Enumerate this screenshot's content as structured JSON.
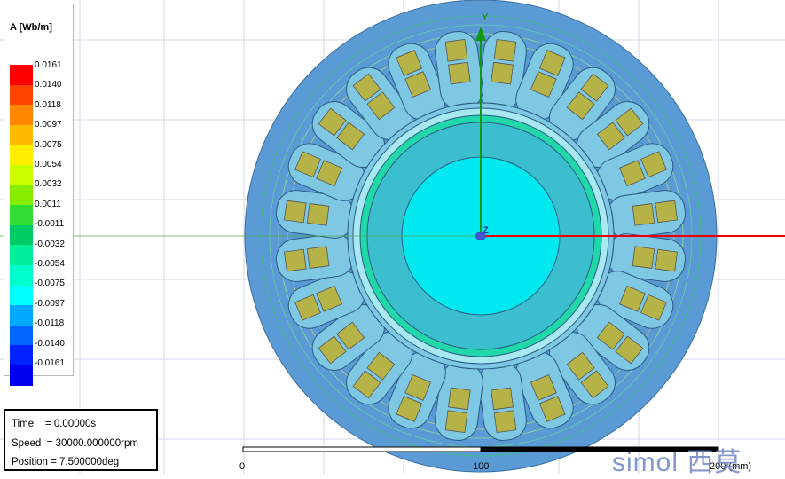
{
  "legend": {
    "title": "A [Wb/m]",
    "entries": [
      {
        "label": "0.0161",
        "color": "#ff0000"
      },
      {
        "label": "0.0140",
        "color": "#ff4400"
      },
      {
        "label": "0.0118",
        "color": "#ff8800"
      },
      {
        "label": "0.0097",
        "color": "#ffbb00"
      },
      {
        "label": "0.0075",
        "color": "#ffee00"
      },
      {
        "label": "0.0054",
        "color": "#ccff00"
      },
      {
        "label": "0.0032",
        "color": "#88ee00"
      },
      {
        "label": "0.0011",
        "color": "#33dd33"
      },
      {
        "label": "-0.0011",
        "color": "#00cc66"
      },
      {
        "label": "-0.0032",
        "color": "#00ee99"
      },
      {
        "label": "-0.0054",
        "color": "#00ffcc"
      },
      {
        "label": "-0.0075",
        "color": "#00ffff"
      },
      {
        "label": "-0.0097",
        "color": "#00aaff"
      },
      {
        "label": "-0.0118",
        "color": "#0066ff"
      },
      {
        "label": "-0.0140",
        "color": "#0022ff"
      },
      {
        "label": "-0.0161",
        "color": "#0000ee"
      }
    ]
  },
  "info": {
    "time_label": "Time",
    "time_value": "= 0.00000s",
    "speed_label": "Speed",
    "speed_value": "= 30000.000000rpm",
    "position_label": "Position",
    "position_value": "= 7.500000deg"
  },
  "scale": {
    "tick0": "0",
    "tick1": "100",
    "tick2": "200 (mm)"
  },
  "axes": {
    "y": "Y",
    "z": "Z"
  },
  "watermark": "simol 西莫",
  "model": {
    "slot_count": 24,
    "field_colors": {
      "stator": "#5b9bd5",
      "slot_region": "#7ec8e3",
      "rotor_outer": "#3bbfcf",
      "rotor_inner": "#00e8f0",
      "coil": "#b5b247"
    }
  }
}
